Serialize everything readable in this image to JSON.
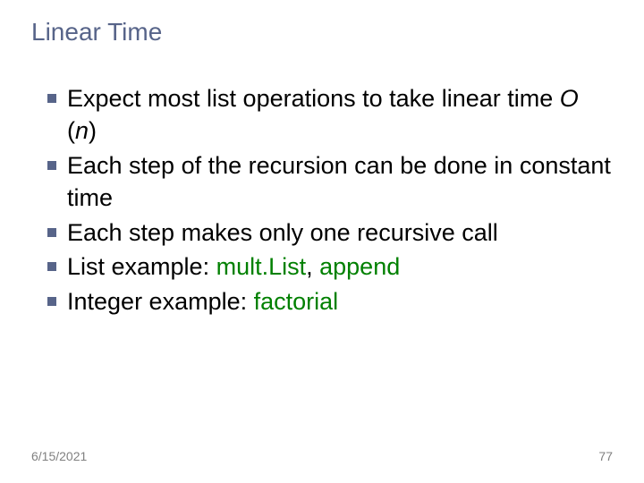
{
  "title": "Linear Time",
  "bullets": {
    "b0_pre": "Expect most list operations to take linear time ",
    "b0_bigO": "O",
    "b0_paren_open": " (",
    "b0_n": "n",
    "b0_paren_close": ")",
    "b1": "Each step of the recursion can be done in constant time",
    "b2": "Each step makes only one recursive call",
    "b3_pre": "List example: ",
    "b3_a": "mult.List",
    "b3_sep": ", ",
    "b3_b": "append",
    "b4_pre": "Integer example: ",
    "b4_a": "factorial"
  },
  "footer": {
    "date": "6/15/2021",
    "page": "77"
  }
}
